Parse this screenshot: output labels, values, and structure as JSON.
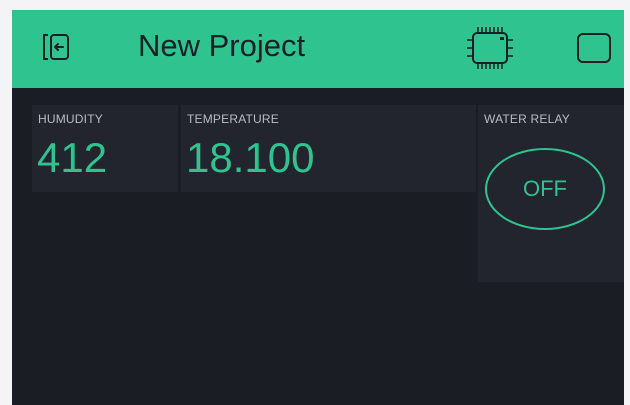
{
  "header": {
    "title": "New Project",
    "exit_icon": "exit-icon",
    "device_icon": "chip-icon",
    "stop_icon": "stop-square-icon"
  },
  "widgets": {
    "humidity": {
      "label": "HUMUDITY",
      "value": "412"
    },
    "temperature": {
      "label": "TEMPERATURE",
      "value": "18.100"
    },
    "water_relay": {
      "label": "WATER RELAY",
      "state": "OFF"
    }
  },
  "colors": {
    "accent": "#2fc48f",
    "background": "#1a1d24",
    "widget_background": "#22252d",
    "label_text": "#b8bcc4",
    "title_text": "#1b1f26"
  }
}
